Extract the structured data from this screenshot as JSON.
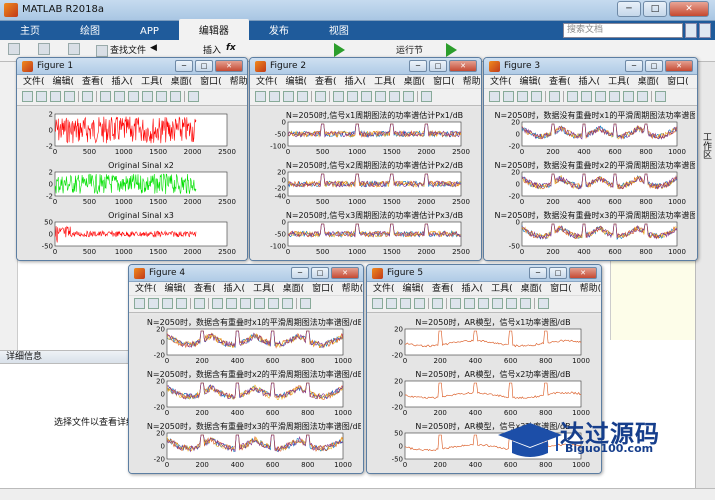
{
  "app": {
    "title": "MATLAB R2018a",
    "tabs": [
      "主页",
      "绘图",
      "APP",
      "编辑器",
      "发布",
      "视图"
    ],
    "active_tab": "编辑器",
    "search_placeholder": "搜索文档",
    "toolbar": {
      "find_files": "查找文件",
      "insert": "插入",
      "fx": "fx",
      "run_section": "运行节"
    },
    "details_title": "详细信息",
    "details_text": "选择文件以查看详细信息",
    "right_panel_label": "工作区"
  },
  "figure_menu": [
    "文件(",
    "编辑(",
    "查看(",
    "插入(",
    "工具(",
    "桌面(",
    "窗口(",
    "帮助("
  ],
  "figures": [
    {
      "name": "Figure 1",
      "plots": [
        {
          "title": "",
          "color": "#ff0000",
          "ylim": [
            -2,
            2
          ],
          "yticks": [
            "2",
            "0",
            "-2"
          ],
          "xticks": [
            "0",
            "500",
            "1000",
            "1500",
            "2000",
            "2500"
          ],
          "xmax": 2500,
          "kind": "noise"
        },
        {
          "title": "Original Sinal x2",
          "color": "#00e000",
          "ylim": [
            -2,
            2
          ],
          "yticks": [
            "2",
            "0",
            "-2"
          ],
          "xticks": [
            "0",
            "500",
            "1000",
            "1500",
            "2000",
            "2500"
          ],
          "xmax": 2500,
          "kind": "noise"
        },
        {
          "title": "Original Sinal x3",
          "color": "#ff0000",
          "ylim": [
            -50,
            50
          ],
          "yticks": [
            "50",
            "0",
            "-50"
          ],
          "xticks": [
            "0",
            "500",
            "1000",
            "1500",
            "2000",
            "2500"
          ],
          "xmax": 2500,
          "kind": "burst"
        }
      ]
    },
    {
      "name": "Figure 2",
      "plots": [
        {
          "title": "N=2050时,信号x1周期图法的功率谱估计Px1/dB",
          "yticks": [
            "0",
            "-50",
            "-100"
          ],
          "xticks": [
            "0",
            "500",
            "1000",
            "1500",
            "2000",
            "2500"
          ],
          "xmax": 2500,
          "kind": "periodogram"
        },
        {
          "title": "N=2050时,信号x2周期图法的功率谱估计Px2/dB",
          "yticks": [
            "20",
            "0",
            "-20",
            "-40"
          ],
          "xticks": [
            "0",
            "500",
            "1000",
            "1500",
            "2000",
            "2500"
          ],
          "xmax": 2500,
          "kind": "periodogram"
        },
        {
          "title": "N=2050时,信号x3周期图法的功率谱估计Px3/dB",
          "yticks": [
            "0",
            "-50",
            "-100"
          ],
          "xticks": [
            "0",
            "500",
            "1000",
            "1500",
            "2000",
            "2500"
          ],
          "xmax": 2500,
          "kind": "periodogram"
        }
      ]
    },
    {
      "name": "Figure 3",
      "plots": [
        {
          "title": "N=2050时，数据没有重叠时x1的平滑周期图法功率谱图/c",
          "yticks": [
            "20",
            "0",
            "-20"
          ],
          "xticks": [
            "0",
            "200",
            "400",
            "600",
            "800",
            "1000"
          ],
          "xmax": 1000,
          "kind": "smooth"
        },
        {
          "title": "N=2050时，数据没有重叠时x2的平滑周期图法功率谱图/c",
          "yticks": [
            "20",
            "0",
            "-20"
          ],
          "xticks": [
            "0",
            "200",
            "400",
            "600",
            "800",
            "1000"
          ],
          "xmax": 1000,
          "kind": "smooth"
        },
        {
          "title": "N=2050时，数据没有重叠时x3的平滑周期图法功率谱图/c",
          "yticks": [
            "0",
            "-50"
          ],
          "xticks": [
            "0",
            "200",
            "400",
            "600",
            "800",
            "1000"
          ],
          "xmax": 1000,
          "kind": "smooth"
        }
      ]
    },
    {
      "name": "Figure 4",
      "plots": [
        {
          "title": "N=2050时，数据含有重叠时x1的平滑周期图法功率谱图/dB",
          "yticks": [
            "20",
            "0",
            "-20"
          ],
          "xticks": [
            "0",
            "200",
            "400",
            "600",
            "800",
            "1000"
          ],
          "xmax": 1000,
          "kind": "smooth"
        },
        {
          "title": "N=2050时，数据含有重叠时x2的平滑周期图法功率谱图/dB",
          "yticks": [
            "20",
            "0",
            "-20"
          ],
          "xticks": [
            "0",
            "200",
            "400",
            "600",
            "800",
            "1000"
          ],
          "xmax": 1000,
          "kind": "smooth"
        },
        {
          "title": "N=2050时，数据含有重叠时x3的平滑周期图法功率谱图/dB",
          "yticks": [
            "20",
            "0",
            "-20"
          ],
          "xticks": [
            "0",
            "200",
            "400",
            "600",
            "800",
            "1000"
          ],
          "xmax": 1000,
          "kind": "smooth"
        }
      ]
    },
    {
      "name": "Figure 5",
      "plots": [
        {
          "title": "N=2050时，AR模型，信号x1功率谱图/dB",
          "yticks": [
            "20",
            "0",
            "-20"
          ],
          "xticks": [
            "0",
            "200",
            "400",
            "600",
            "800",
            "1000"
          ],
          "xmax": 1000,
          "kind": "ar"
        },
        {
          "title": "N=2050时，AR模型，信号x2功率谱图/dB",
          "yticks": [
            "20",
            "0",
            "-20"
          ],
          "xticks": [
            "0",
            "200",
            "400",
            "600",
            "800",
            "1000"
          ],
          "xmax": 1000,
          "kind": "ar"
        },
        {
          "title": "N=2050时，AR模型，信号x3功率谱图/dB",
          "yticks": [
            "50",
            "0",
            "-50"
          ],
          "xticks": [
            "0",
            "200",
            "400",
            "600",
            "800",
            "1000"
          ],
          "xmax": 1000,
          "kind": "ar"
        }
      ]
    }
  ],
  "watermark": {
    "text": "达过源码",
    "sub": "Biguo100.com"
  }
}
